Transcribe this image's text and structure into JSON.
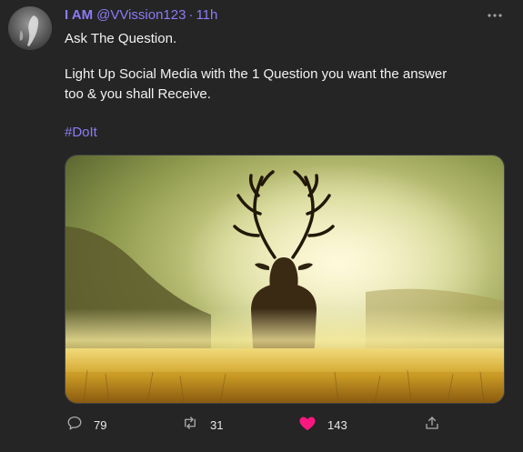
{
  "tweet": {
    "display_name": "I AM",
    "handle": "@VVission123",
    "separator": "·",
    "time": "11h",
    "line1": "Ask The Question.",
    "line2": "Light Up Social Media with the 1 Question you want the answer",
    "line3": "too & you shall Receive.",
    "hashtag": "#DoIt"
  },
  "actions": {
    "reply_count": "79",
    "retweet_count": "31",
    "like_count": "143"
  },
  "colors": {
    "accent": "#8b7cf6",
    "like": "#f91880",
    "background": "#252525"
  },
  "icons": {
    "more": "more-icon",
    "reply": "reply-icon",
    "retweet": "retweet-icon",
    "like": "heart-icon",
    "share": "share-icon"
  }
}
